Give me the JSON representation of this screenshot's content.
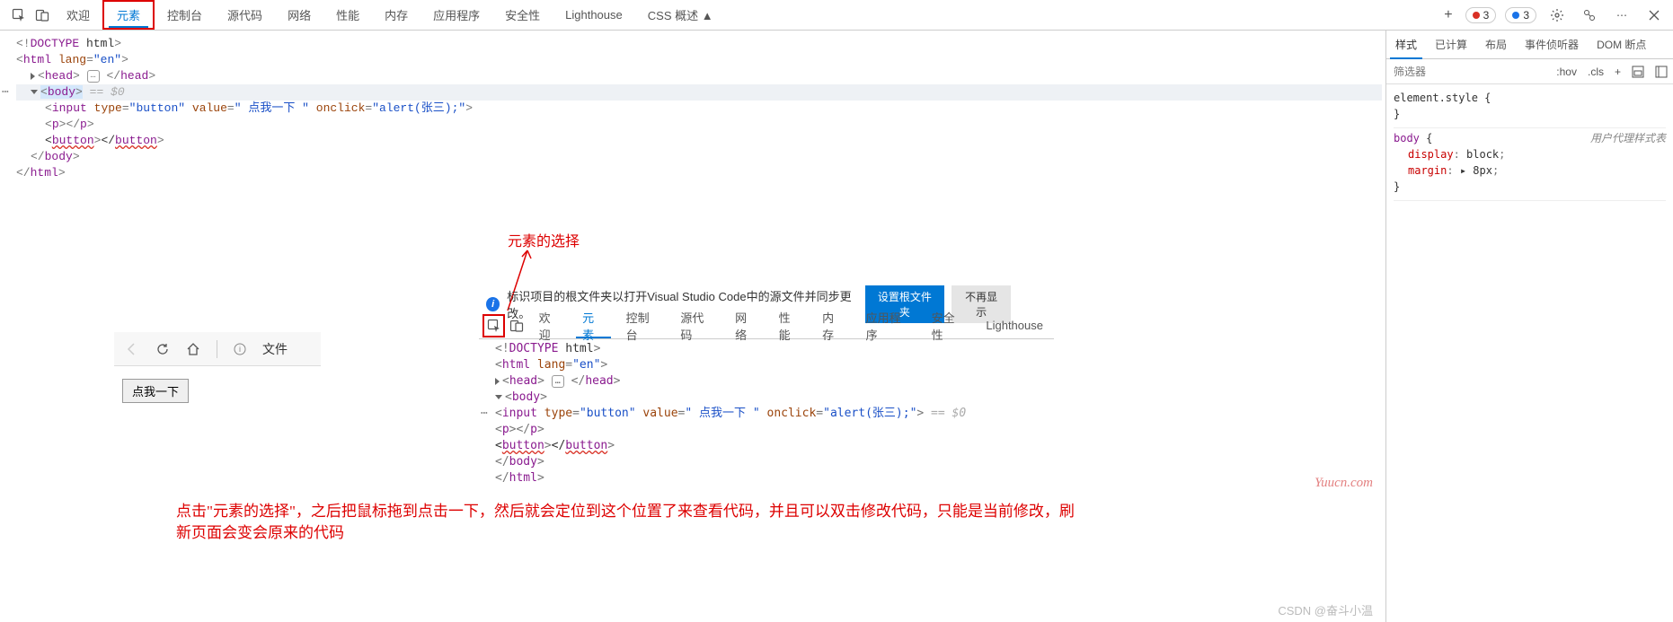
{
  "toolbar": {
    "tabs": [
      "欢迎",
      "元素",
      "控制台",
      "源代码",
      "网络",
      "性能",
      "内存",
      "应用程序",
      "安全性",
      "Lighthouse",
      "CSS 概述 ▲"
    ],
    "active_index": 1,
    "highlighted_index": 1,
    "errors_count": "3",
    "issues_count": "3"
  },
  "dom_tree_top": {
    "lines": [
      {
        "ind": 0,
        "content": "<!DOCTYPE html>"
      },
      {
        "ind": 0,
        "content": "<html lang=\"en\">"
      },
      {
        "ind": 1,
        "pre": "tri-right",
        "content": "<head>",
        "badge": "…",
        "after": "</head>"
      },
      {
        "ind": 1,
        "pre": "tri-down",
        "sel": true,
        "content": "<body>",
        "ghost": " == $0",
        "dots": true,
        "rowsel": true
      },
      {
        "ind": 2,
        "content": "<input type=\"button\" value=\" 点我一下 \" onclick=\"alert(张三);\">"
      },
      {
        "ind": 2,
        "content": "<p></p>"
      },
      {
        "ind": 2,
        "wavy": "button",
        "content": "<button></button>"
      },
      {
        "ind": 1,
        "content": "</body>"
      },
      {
        "ind": 0,
        "content": "</html>"
      }
    ]
  },
  "styles": {
    "tabs": [
      "样式",
      "已计算",
      "布局",
      "事件侦听器",
      "DOM 断点"
    ],
    "active_index": 0,
    "filter_placeholder": "筛选器",
    "hov": ":hov",
    "cls": ".cls",
    "elem_style": "element.style {",
    "body_selector": "body",
    "ua_label": "用户代理样式表",
    "rules": [
      {
        "name": "display",
        "value": "block"
      },
      {
        "name": "margin",
        "value": "8px",
        "arrow": true
      }
    ]
  },
  "info_bar": {
    "text": "标识项目的根文件夹以打开Visual Studio Code中的源文件并同步更改。",
    "btn_set": "设置根文件夹",
    "btn_hide": "不再显示"
  },
  "inner_toolbar": {
    "tabs": [
      "欢迎",
      "元素",
      "控制台",
      "源代码",
      "网络",
      "性能",
      "内存",
      "应用程序",
      "安全性",
      "Lighthouse"
    ],
    "active_index": 1
  },
  "dom_tree_inner": {
    "lines": [
      {
        "ind": 0,
        "content": "<!DOCTYPE html>"
      },
      {
        "ind": 0,
        "content": "<html lang=\"en\">"
      },
      {
        "ind": 1,
        "pre": "tri-right",
        "content": "<head>",
        "badge": "…",
        "after": "</head>"
      },
      {
        "ind": 1,
        "pre": "tri-down",
        "content": "<body>"
      },
      {
        "ind": 2,
        "sel": true,
        "content": "<input type=\"button\" value=\" 点我一下 \" onclick=\"alert(张三);\">",
        "ghost": " == $0",
        "dots": true
      },
      {
        "ind": 2,
        "content": "<p></p>"
      },
      {
        "ind": 2,
        "wavy": "button",
        "content": "<button></button>"
      },
      {
        "ind": 1,
        "content": "</body>"
      },
      {
        "ind": 0,
        "content": "</html>"
      }
    ]
  },
  "browser": {
    "addr_prefix": "文件",
    "button_label": "点我一下"
  },
  "anno": {
    "title": "元素的选择",
    "text": "点击\"元素的选择\"，之后把鼠标拖到点击一下，然后就会定位到这个位置了来查看代码，并且可以双击修改代码，只能是当前修改，刷新页面会变会原来的代码"
  },
  "watermarks": {
    "w1": "Yuucn.com",
    "w2": "CSDN @奋斗小温"
  }
}
